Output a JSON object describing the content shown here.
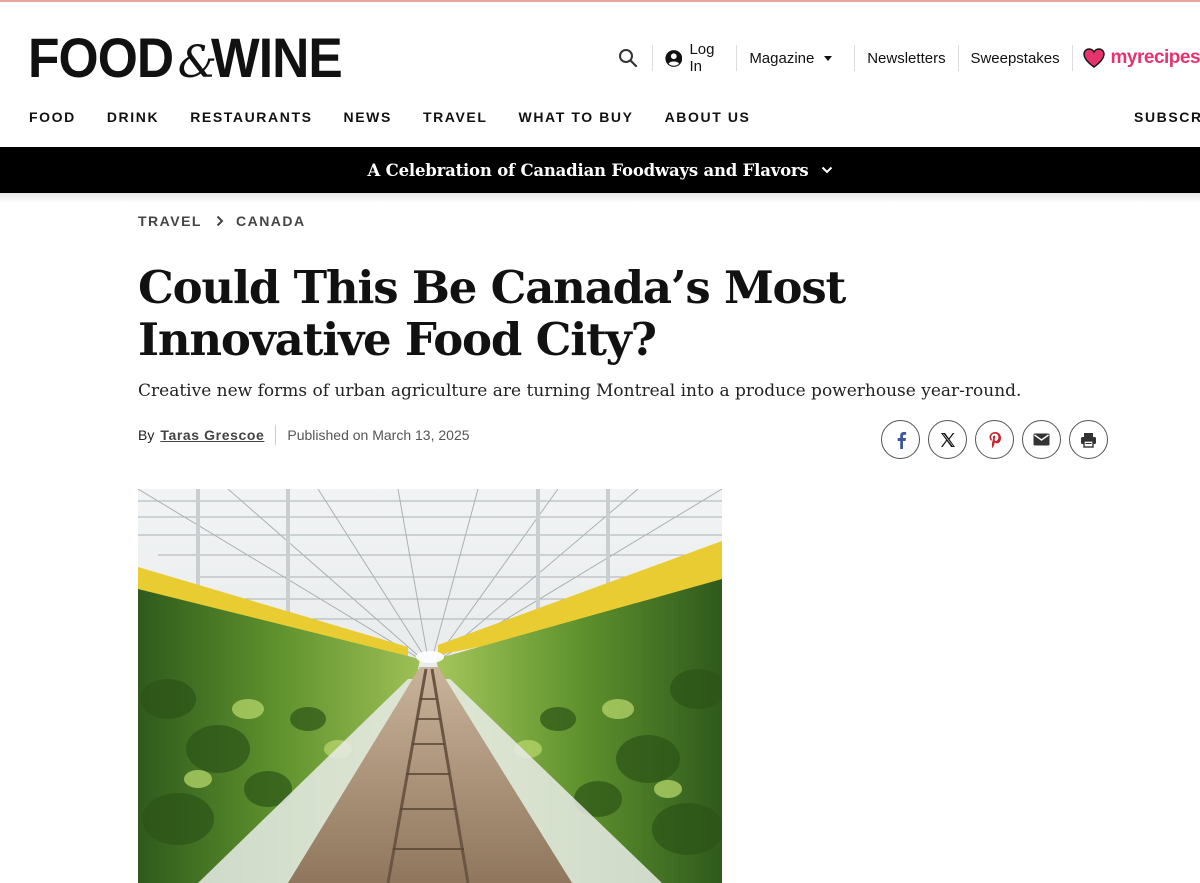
{
  "header": {
    "logo_part1": "FOOD",
    "logo_amp": "&",
    "logo_part2": "WINE",
    "login_label": "Log In",
    "magazine_label": "Magazine",
    "newsletters_label": "Newsletters",
    "sweepstakes_label": "Sweepstakes",
    "partner_label": "myrecipes"
  },
  "nav": {
    "items": [
      "FOOD",
      "DRINK",
      "RESTAURANTS",
      "NEWS",
      "TRAVEL",
      "WHAT TO BUY",
      "ABOUT US"
    ],
    "subscribe_label": "SUBSCRIBE"
  },
  "banner": {
    "text": "A Celebration of Canadian Foodways and Flavors"
  },
  "breadcrumb": {
    "items": [
      "TRAVEL",
      "CANADA"
    ]
  },
  "article": {
    "title": "Could This Be Canada’s Most Innovative Food City?",
    "dek": "Creative new forms of urban agriculture are turning Montreal into a produce powerhouse year-round.",
    "by_label": "By",
    "author": "Taras Grescoe",
    "published": "Published on March 13, 2025"
  },
  "share": {
    "icons": [
      "facebook-icon",
      "x-icon",
      "pinterest-icon",
      "email-icon",
      "print-icon"
    ]
  },
  "colors": {
    "brand_pink": "#e6336e",
    "banner_bg": "#000000",
    "facebook": "#3b5998",
    "pinterest": "#c8232c"
  }
}
